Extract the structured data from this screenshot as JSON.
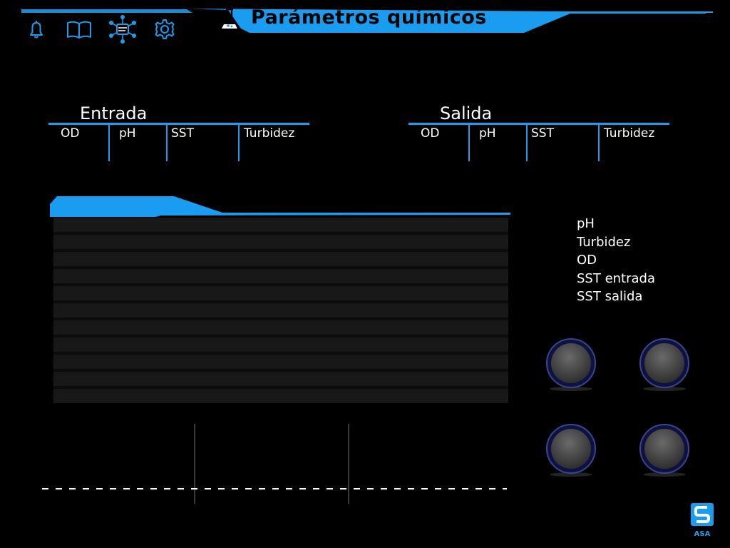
{
  "header": {
    "title": "Parámetros químicos",
    "nav_icons": [
      "bell-icon",
      "book-icon",
      "network-icon",
      "gear-icon"
    ],
    "title_icon": "flask-icon"
  },
  "colors": {
    "accent": "#1a9cf0",
    "background": "#000000",
    "knob": "#4a4a4a"
  },
  "entrada": {
    "title": "Entrada",
    "columns": [
      "OD",
      "pH",
      "SST",
      "Turbidez"
    ]
  },
  "salida": {
    "title": "Salida",
    "columns": [
      "OD",
      "pH",
      "SST",
      "Turbidez"
    ]
  },
  "legend": {
    "items": [
      "pH",
      "Turbidez",
      "OD",
      "SST entrada",
      "SST salida"
    ]
  },
  "knobs": [
    "knob-1",
    "knob-2",
    "knob-3",
    "knob-4"
  ],
  "logo": {
    "text": "ASA"
  }
}
